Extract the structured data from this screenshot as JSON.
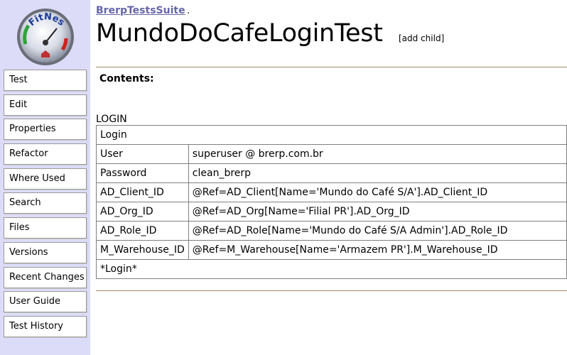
{
  "sidebar": {
    "logo_icon": "fitnesse-gauge-logo-icon",
    "items": [
      {
        "label": "Test"
      },
      {
        "label": "Edit"
      },
      {
        "label": "Properties"
      },
      {
        "label": "Refactor"
      },
      {
        "label": "Where Used"
      },
      {
        "label": "Search"
      },
      {
        "label": "Files"
      },
      {
        "label": "Versions"
      },
      {
        "label": "Recent Changes"
      },
      {
        "label": "User Guide"
      },
      {
        "label": "Test History"
      }
    ]
  },
  "header": {
    "breadcrumb": "BrerpTestsSuite",
    "breadcrumb_separator": ".",
    "title": "MundoDoCafeLoginTest",
    "add_child": "[add child]"
  },
  "content": {
    "contents_label": "Contents:",
    "table_caption": "LOGIN",
    "table": {
      "header": "Login",
      "rows": [
        {
          "key": "User",
          "value": "superuser @ brerp.com.br"
        },
        {
          "key": "Password",
          "value": "clean_brerp"
        },
        {
          "key": "AD_Client_ID",
          "value": "@Ref=AD_Client[Name='Mundo do Café S/A'].AD_Client_ID"
        },
        {
          "key": "AD_Org_ID",
          "value": "@Ref=AD_Org[Name='Filial PR'].AD_Org_ID"
        },
        {
          "key": "AD_Role_ID",
          "value": "@Ref=AD_Role[Name='Mundo do Café S/A Admin'].AD_Role_ID"
        },
        {
          "key": "M_Warehouse_ID",
          "value": "@Ref=M_Warehouse[Name='Armazem PR'].M_Warehouse_ID"
        }
      ],
      "footer": "*Login*"
    }
  },
  "colors": {
    "sidebar_bg": "#dcdcf8",
    "link": "#6666aa",
    "rule": "#a08868",
    "table_border": "#808080"
  }
}
